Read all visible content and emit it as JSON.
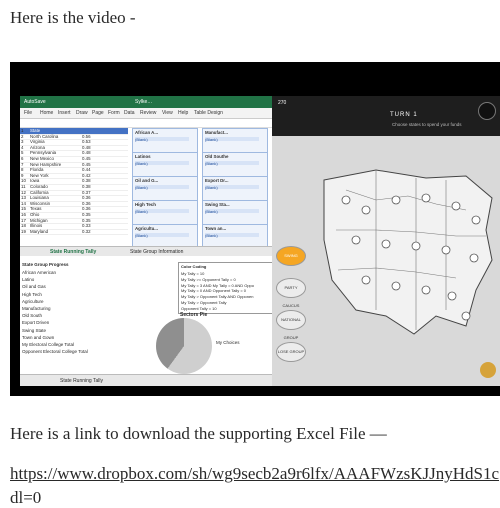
{
  "text": {
    "intro": "Here is the video -",
    "link_intro": "Here is a link to download the supporting Excel File —",
    "url_line1": "https://www.dropbox.com/sh/wg9secb2a9r6lfx/AAAFWzsKJJnyHdS1c",
    "url_line2": "dl=0"
  },
  "excel": {
    "menu": [
      "File",
      "Home",
      "Insert",
      "Draw",
      "Page",
      "Form",
      "Data",
      "Review",
      "View",
      "Help",
      "Table Design"
    ],
    "sheet_tab_active": "State Running Tally",
    "sheet_tab_other": "State Group Information",
    "table_rows": [
      {
        "idx": "1",
        "state": "State"
      },
      {
        "idx": "2",
        "state": "North Carolina",
        "v": "0.56"
      },
      {
        "idx": "3",
        "state": "Virginia",
        "v": "0.53"
      },
      {
        "idx": "4",
        "state": "Arizona",
        "v": "0.48"
      },
      {
        "idx": "5",
        "state": "Pennsylvania",
        "v": "0.48"
      },
      {
        "idx": "6",
        "state": "New Mexico",
        "v": "0.45"
      },
      {
        "idx": "7",
        "state": "New Hampshire",
        "v": "0.45"
      },
      {
        "idx": "8",
        "state": "Florida",
        "v": "0.44"
      },
      {
        "idx": "9",
        "state": "New York",
        "v": "0.42"
      },
      {
        "idx": "10",
        "state": "Iowa",
        "v": "0.38"
      },
      {
        "idx": "11",
        "state": "Colorado",
        "v": "0.38"
      },
      {
        "idx": "12",
        "state": "California",
        "v": "0.37"
      },
      {
        "idx": "13",
        "state": "Louisiana",
        "v": "0.36"
      },
      {
        "idx": "14",
        "state": "Wisconsin",
        "v": "0.36"
      },
      {
        "idx": "15",
        "state": "Texas",
        "v": "0.36"
      },
      {
        "idx": "16",
        "state": "Ohio",
        "v": "0.35"
      },
      {
        "idx": "17",
        "state": "Michigan",
        "v": "0.35"
      },
      {
        "idx": "18",
        "state": "Illinois",
        "v": "0.33"
      },
      {
        "idx": "19",
        "state": "Maryland",
        "v": "0.32"
      }
    ],
    "cards": [
      "African A...",
      "Manufact...",
      "Latinos",
      "Old Southe",
      "Oil and G...",
      "Export Dr...",
      "High Tech",
      "Swing Sta...",
      "Agricultu...",
      "Town an..."
    ],
    "card_value": "(Blank)",
    "lower_title": "State Group Progress",
    "lower_items": [
      "African American",
      "Latino",
      "Oil and Gas",
      "High Tech",
      "Agriculture",
      "Manufacturing",
      "Old South",
      "Export Driven",
      "Swing State",
      "Town and Gown",
      "My Electoral College Total",
      "Opponent Electoral College Total"
    ],
    "color_coding_title": "Color Coding",
    "color_coding": [
      "My Tally = 10",
      "My Tally >= Opponent Tally = 0",
      "My Tally = 3 AND My Tally = 0 AND Oppo",
      "My Tally = 0 AND Opponent Tally = 0",
      "My Tally > Opponent Tally AND Opponen",
      "My Tally > Opponent Tally",
      "Opponent Tally = 10"
    ],
    "pie_title": "Sectors Pie",
    "pie_legend": "My Choices"
  },
  "game": {
    "turn_label": "TURN 1",
    "hint": "Choose states to spend your funds",
    "score": "270",
    "buttons": [
      "SWING",
      "PARTY\nCAUCUS",
      "NATIONAL\nGROUP",
      "LOSE\nGROUP"
    ]
  }
}
